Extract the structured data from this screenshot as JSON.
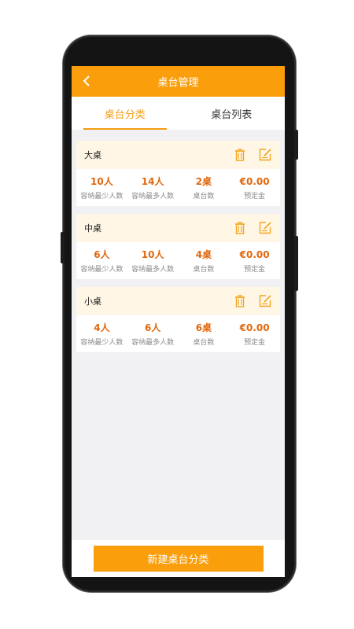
{
  "header": {
    "title": "桌台管理"
  },
  "tabs": [
    {
      "label": "桌台分类",
      "active": true
    },
    {
      "label": "桌台列表",
      "active": false
    }
  ],
  "categories": [
    {
      "name": "大桌",
      "stats": [
        {
          "value": "10人",
          "label": "容纳最少人数"
        },
        {
          "value": "14人",
          "label": "容纳最多人数"
        },
        {
          "value": "2桌",
          "label": "桌台数"
        },
        {
          "value": "€0.00",
          "label": "预定金"
        }
      ]
    },
    {
      "name": "中桌",
      "stats": [
        {
          "value": "6人",
          "label": "容纳最少人数"
        },
        {
          "value": "10人",
          "label": "容纳最多人数"
        },
        {
          "value": "4桌",
          "label": "桌台数"
        },
        {
          "value": "€0.00",
          "label": "预定金"
        }
      ]
    },
    {
      "name": "小桌",
      "stats": [
        {
          "value": "4人",
          "label": "容纳最少人数"
        },
        {
          "value": "6人",
          "label": "容纳最多人数"
        },
        {
          "value": "6桌",
          "label": "桌台数"
        },
        {
          "value": "€0.00",
          "label": "预定金"
        }
      ]
    }
  ],
  "footer": {
    "new_button_label": "新建桌台分类"
  },
  "icons": {
    "back": "chevron-left-icon",
    "delete": "trash-icon",
    "edit": "edit-icon"
  },
  "colors": {
    "accent": "#fa9e0b",
    "value_text": "#e0680f",
    "card_header_bg": "#fff6e6",
    "screen_bg": "#f1f1f4"
  }
}
